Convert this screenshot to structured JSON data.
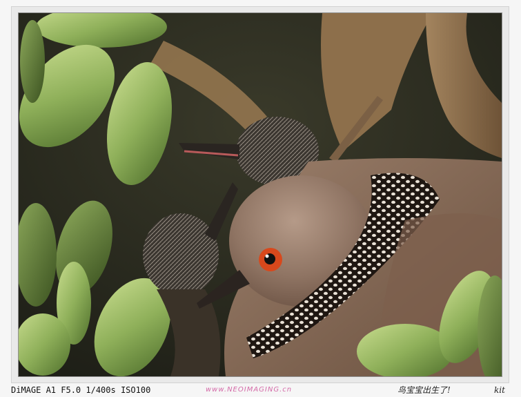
{
  "image": {
    "subject": "spotted-dove-with-chicks",
    "caption_exif": "DiMAGE A1 F5.0 1/400s ISO100",
    "caption_site": "www.NEOIMAGING.cn",
    "caption_title": "鸟宝宝出生了!",
    "caption_signature": "kit",
    "colors": {
      "frame": "#e9e9e9",
      "background_dark": "#2d2c20",
      "succulent": "#9dbb6a",
      "dove_body": "#8a6a56",
      "dove_eye": "#d8481c",
      "branch": "#8a6a45"
    }
  }
}
